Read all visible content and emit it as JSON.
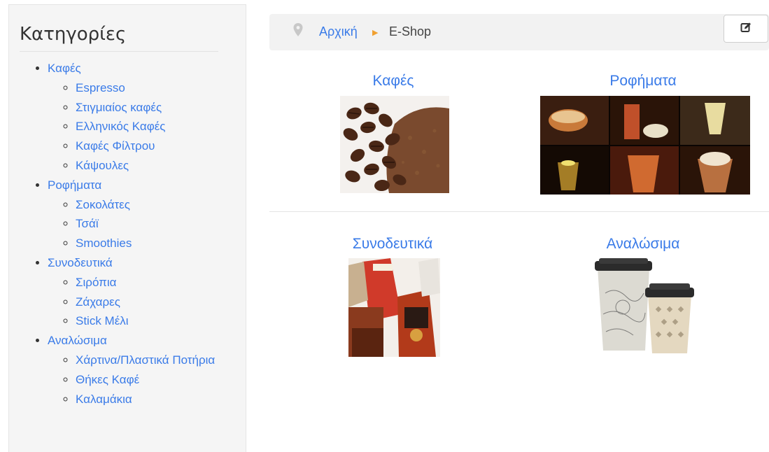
{
  "sidebar": {
    "title": "Κατηγορίες",
    "categories": [
      {
        "label": "Καφές",
        "children": [
          "Espresso",
          "Στιγμιαίος καφές",
          "Ελληνικός Καφές",
          "Καφές Φίλτρου",
          "Κάψουλες"
        ]
      },
      {
        "label": "Ροφήματα",
        "children": [
          "Σοκολάτες",
          "Τσάϊ",
          "Smoothies"
        ]
      },
      {
        "label": "Συνοδευτικά",
        "children": [
          "Σιρόπια",
          "Ζάχαρες",
          "Stick Μέλι"
        ]
      },
      {
        "label": "Αναλώσιμα",
        "children": [
          "Χάρτινα/Πλαστικά Ποτήρια",
          "Θήκες Καφέ",
          "Καλαμάκια"
        ]
      }
    ]
  },
  "breadcrumb": {
    "icon": "map-marker-icon",
    "home": "Αρχική",
    "separator_icon": "caret-right-icon",
    "current": "E-Shop"
  },
  "toolbar": {
    "edit_icon": "edit-icon"
  },
  "tiles": [
    {
      "title": "Καφές"
    },
    {
      "title": "Ροφήματα"
    },
    {
      "title": "Συνοδευτικά"
    },
    {
      "title": "Αναλώσιμα"
    }
  ],
  "colors": {
    "link": "#3a7be8",
    "separator": "#f0a030",
    "sidebar_bg": "#f5f5f5",
    "breadcrumb_bg": "#f2f2f2"
  }
}
